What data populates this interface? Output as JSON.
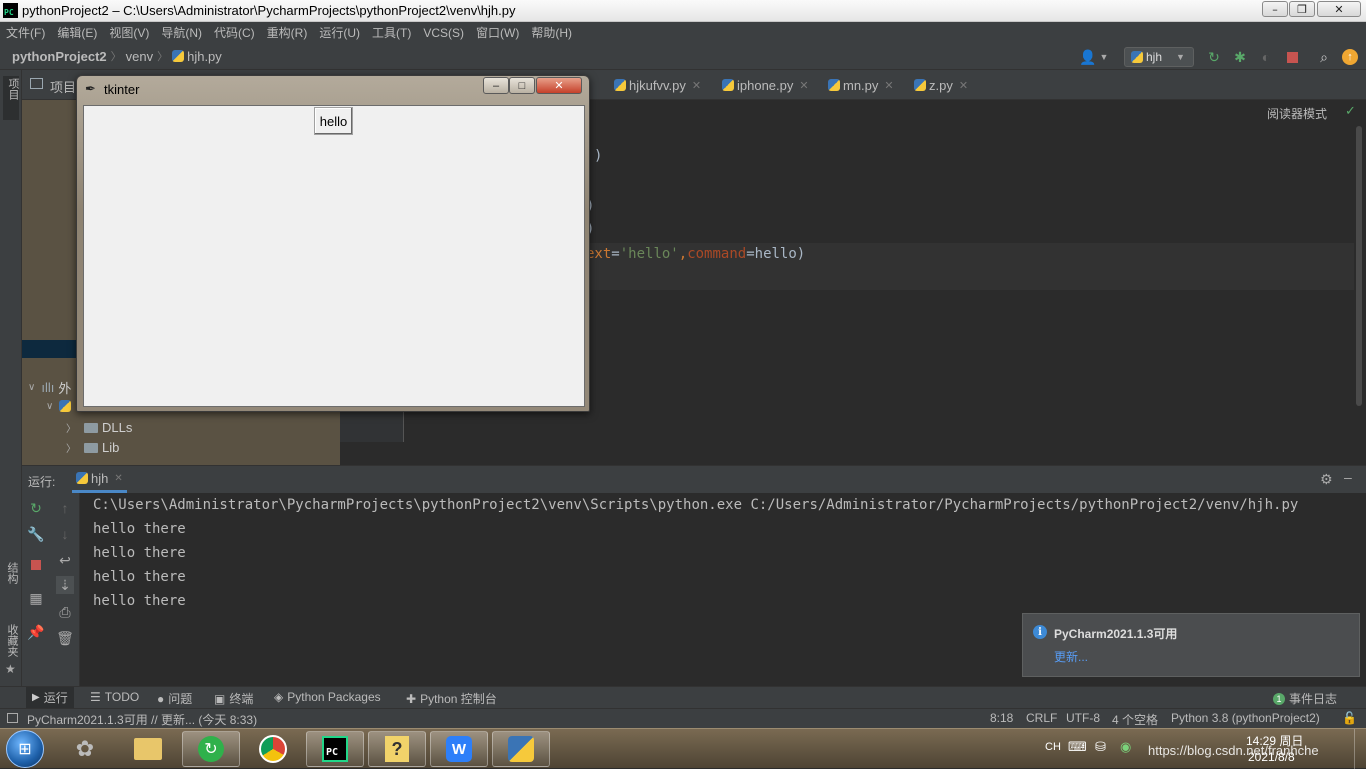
{
  "window": {
    "title": "pythonProject2 – C:\\Users\\Administrator\\PycharmProjects\\pythonProject2\\venv\\hjh.py",
    "app_icon": "PC",
    "controls": [
      "–",
      "❐",
      "✕"
    ]
  },
  "menu": [
    "文件(F)",
    "编辑(E)",
    "视图(V)",
    "导航(N)",
    "代码(C)",
    "重构(R)",
    "运行(U)",
    "工具(T)",
    "VCS(S)",
    "窗口(W)",
    "帮助(H)"
  ],
  "breadcrumb": {
    "project": "pythonProject2",
    "folder": "venv",
    "file": "hjh.py"
  },
  "toolbar": {
    "run_config": "hjh"
  },
  "left_strip": {
    "project": "项目",
    "structure": "结构",
    "favorites": "收藏夹"
  },
  "project_panel": {
    "header": "项目",
    "items": [
      {
        "label": "外",
        "kind": "library"
      },
      {
        "label": "DLLs",
        "kind": "folder"
      },
      {
        "label": "Lib",
        "kind": "folder"
      }
    ]
  },
  "tabs": [
    {
      "label": "hjkufvv.py"
    },
    {
      "label": "iphone.py"
    },
    {
      "label": "mn.py"
    },
    {
      "label": "z.py"
    }
  ],
  "editor": {
    "reader_mode": "阅读器模式",
    "code_line": {
      "prefix": "ext",
      "eq1": "=",
      "str": "'hello'",
      "comma": ",",
      "kw": "command",
      "eq2": "=",
      "val": "hello",
      "close": ")"
    },
    "fragments": [
      ")",
      ")",
      ")"
    ]
  },
  "run": {
    "label": "运行:",
    "tab": "hjh",
    "output": [
      "C:\\Users\\Administrator\\PycharmProjects\\pythonProject2\\venv\\Scripts\\python.exe C:/Users/Administrator/PycharmProjects/pythonProject2/venv/hjh.py",
      "hello there",
      "hello there",
      "hello there",
      "hello there"
    ]
  },
  "notification": {
    "title": "PyCharm2021.1.3可用",
    "link": "更新..."
  },
  "tool_tabs": [
    "运行",
    "TODO",
    "问题",
    "终端",
    "Python Packages",
    "Python 控制台"
  ],
  "event_log": {
    "count": "1",
    "label": "事件日志"
  },
  "status": {
    "message": "PyCharm2021.1.3可用 // 更新... (今天 8:33)",
    "position": "8:18",
    "line_sep": "CRLF",
    "encoding": "UTF-8",
    "indent": "4 个空格",
    "interpreter": "Python 3.8 (pythonProject2)"
  },
  "tk_window": {
    "title": "tkinter",
    "button": "hello",
    "controls": [
      "–",
      "□",
      "✕"
    ]
  },
  "taskbar": {
    "tray_lang": "CH",
    "time": "14:29 周日",
    "date": "2021/8/8",
    "watermark": "https://blog.csdn.net/franhche"
  },
  "colors": {
    "ide_bg": "#2b2b2b",
    "panel_bg": "#3c3f41",
    "string": "#6a8759",
    "keyword": "#cc7832",
    "link": "#589df6",
    "stop": "#c75450",
    "run_green": "#59a869"
  }
}
